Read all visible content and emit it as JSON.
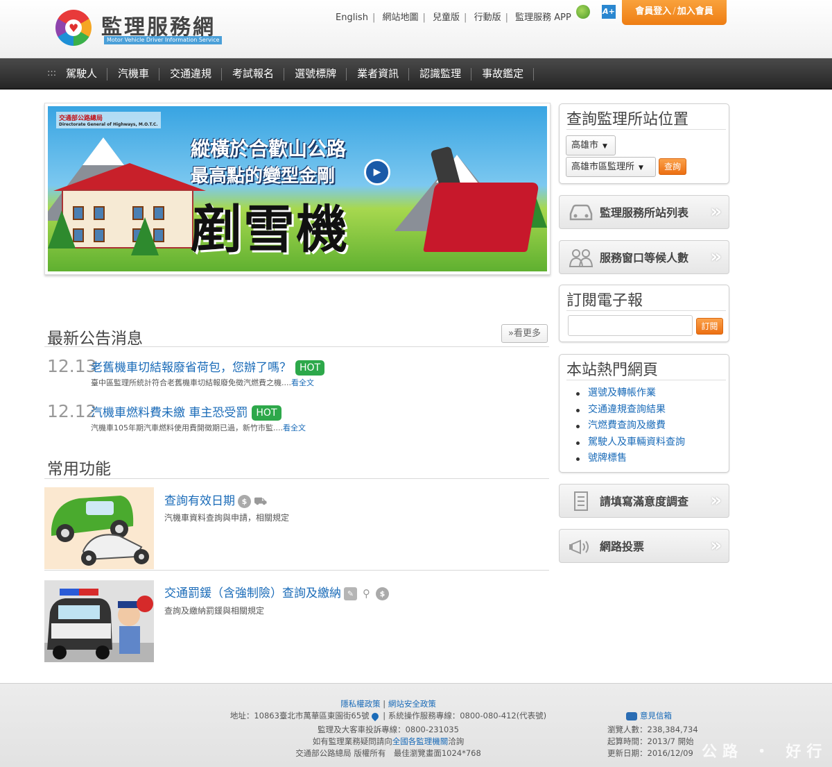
{
  "header": {
    "site_title": "監理服務網",
    "site_subtitle": "Motor Vehicle Driver Information Service",
    "top_links": [
      "English",
      "網站地圖",
      "兒童版",
      "行動版",
      "監理服務 APP"
    ],
    "member_login": "會員登入",
    "member_join": "加入會員"
  },
  "nav": {
    "items": [
      "駕駛人",
      "汽機車",
      "交通違規",
      "考試報名",
      "選號標牌",
      "業者資訊",
      "認識監理",
      "事故鑑定"
    ]
  },
  "banner": {
    "agency_name": "交通部公路總局",
    "agency_english": "Directorate General of Highways, M.O.T.C.",
    "line1": "縱橫於合歡山公路",
    "line2": "最高點的變型金剛",
    "big_text": "剷雪機"
  },
  "news": {
    "title": "最新公告消息",
    "more": "»看更多",
    "items": [
      {
        "date": "12.13",
        "title": "老舊機車切結報廢省荷包，您辦了嗎？",
        "badge": "HOT",
        "desc": "臺中區監理所統計符合老舊機車切結報廢免徵汽燃費之機....",
        "read_more": "看全文"
      },
      {
        "date": "12.12",
        "title": "汽機車燃料費未繳 車主恐受罰",
        "badge": "HOT",
        "desc": "汽機車105年期汽車燃料使用費開徵期已過，新竹市監....",
        "read_more": "看全文"
      }
    ]
  },
  "functions": {
    "title": "常用功能",
    "items": [
      {
        "title": "查詢有效日期",
        "desc": "汽機車資料查詢與申請，相關規定"
      },
      {
        "title": "交通罰鍰（含強制險）查詢及繳納",
        "desc": "查詢及繳納罰鍰與相關規定"
      }
    ]
  },
  "sidebar": {
    "location": {
      "title": "查詢監理所站位置",
      "city_value": "高雄市",
      "office_value": "高雄市區監理所",
      "query_button": "查詢"
    },
    "station_list": "監理服務所站列表",
    "waiting": "服務窗口等候人數",
    "newsletter": {
      "title": "訂閱電子報",
      "input_value": "",
      "subscribe_button": "訂閱"
    },
    "popular": {
      "title": "本站熱門網頁",
      "items": [
        "選號及轉帳作業",
        "交通違規查詢結果",
        "汽燃費查詢及繳費",
        "駕駛人及車輛資料查詢",
        "號牌標售"
      ]
    },
    "survey": "請填寫滿意度調查",
    "vote": "網路投票"
  },
  "footer": {
    "privacy": "隱私權政策",
    "security": "網站安全政策",
    "address": "地址：10863臺北市萬華區東園街65號",
    "hotline": "系統操作服務專線：0800-080-412(代表號)",
    "bus_hotline": "監理及大客車投訴專線：0800-231035",
    "inquiry_prefix": "如有監理業務疑問請向",
    "inquiry_link": "全國各監理機關",
    "inquiry_suffix": "洽詢",
    "copyright": "交通部公路總局 版權所有　最佳瀏覽畫面1024*768",
    "mailbox": "意見信箱",
    "visitors": "瀏覽人數：238,384,734",
    "start": "起算時間：2013/7 開始",
    "updated": "更新日期：2016/12/09",
    "watermark": "公路 ・ 好行"
  },
  "colors": {
    "accent_orange": "#ee7d13",
    "link_blue": "#1a6bb8",
    "hot_green": "#2da84a",
    "nav_dark": "#262626"
  },
  "icons": [
    "site-logo",
    "globe-icon",
    "accessibility-icon",
    "car-icon",
    "people-icon",
    "document-icon",
    "megaphone-icon",
    "chevron-double-right-icon",
    "map-pin-icon",
    "envelope-icon",
    "dollar-icon",
    "car-outline-icon",
    "edit-icon",
    "search-icon",
    "play-icon"
  ]
}
